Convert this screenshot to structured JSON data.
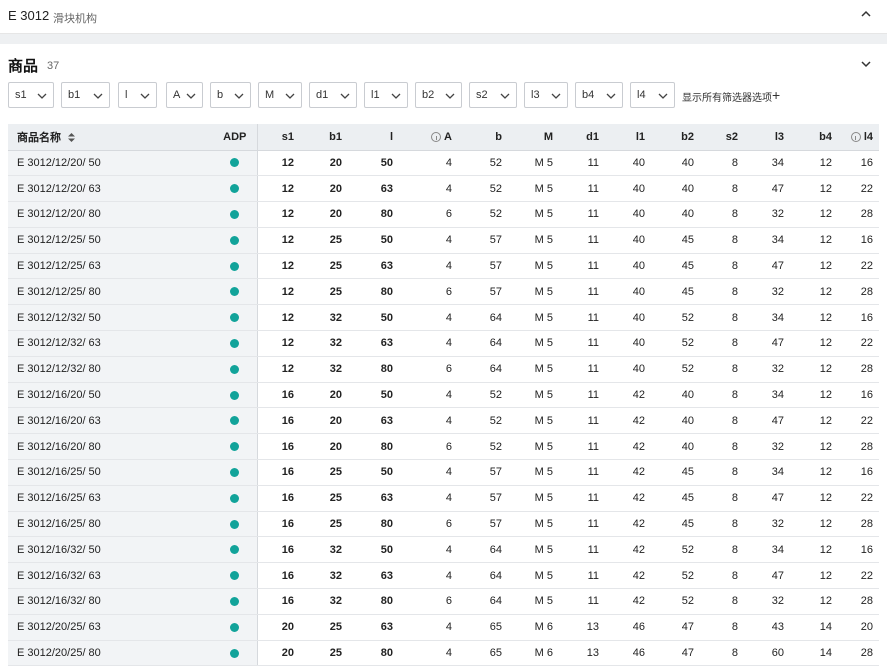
{
  "header": {
    "code": "E 3012",
    "subtitle": "滑块机构"
  },
  "section": {
    "title": "商品",
    "count": "37"
  },
  "filters": [
    {
      "label": "s1"
    },
    {
      "label": "b1"
    },
    {
      "label": "l"
    },
    {
      "label": "A"
    },
    {
      "label": "b"
    },
    {
      "label": "M"
    },
    {
      "label": "d1"
    },
    {
      "label": "l1"
    },
    {
      "label": "b2"
    },
    {
      "label": "s2"
    },
    {
      "label": "l3"
    },
    {
      "label": "b4"
    },
    {
      "label": "l4"
    }
  ],
  "show_all_filters": "显示所有筛选器选项",
  "show_all_plus": "+",
  "table": {
    "columns": [
      "商品名称",
      "ADP",
      "s1",
      "b1",
      "l",
      "A",
      "b",
      "M",
      "d1",
      "l1",
      "b2",
      "s2",
      "l3",
      "b4",
      "l4"
    ],
    "rows": [
      [
        "E 3012/12/20/ 50",
        "12",
        "20",
        "50",
        "4",
        "52",
        "M 5",
        "11",
        "40",
        "40",
        "8",
        "34",
        "12",
        "16"
      ],
      [
        "E 3012/12/20/ 63",
        "12",
        "20",
        "63",
        "4",
        "52",
        "M 5",
        "11",
        "40",
        "40",
        "8",
        "47",
        "12",
        "22"
      ],
      [
        "E 3012/12/20/ 80",
        "12",
        "20",
        "80",
        "6",
        "52",
        "M 5",
        "11",
        "40",
        "40",
        "8",
        "32",
        "12",
        "28"
      ],
      [
        "E 3012/12/25/ 50",
        "12",
        "25",
        "50",
        "4",
        "57",
        "M 5",
        "11",
        "40",
        "45",
        "8",
        "34",
        "12",
        "16"
      ],
      [
        "E 3012/12/25/ 63",
        "12",
        "25",
        "63",
        "4",
        "57",
        "M 5",
        "11",
        "40",
        "45",
        "8",
        "47",
        "12",
        "22"
      ],
      [
        "E 3012/12/25/ 80",
        "12",
        "25",
        "80",
        "6",
        "57",
        "M 5",
        "11",
        "40",
        "45",
        "8",
        "32",
        "12",
        "28"
      ],
      [
        "E 3012/12/32/ 50",
        "12",
        "32",
        "50",
        "4",
        "64",
        "M 5",
        "11",
        "40",
        "52",
        "8",
        "34",
        "12",
        "16"
      ],
      [
        "E 3012/12/32/ 63",
        "12",
        "32",
        "63",
        "4",
        "64",
        "M 5",
        "11",
        "40",
        "52",
        "8",
        "47",
        "12",
        "22"
      ],
      [
        "E 3012/12/32/ 80",
        "12",
        "32",
        "80",
        "6",
        "64",
        "M 5",
        "11",
        "40",
        "52",
        "8",
        "32",
        "12",
        "28"
      ],
      [
        "E 3012/16/20/ 50",
        "16",
        "20",
        "50",
        "4",
        "52",
        "M 5",
        "11",
        "42",
        "40",
        "8",
        "34",
        "12",
        "16"
      ],
      [
        "E 3012/16/20/ 63",
        "16",
        "20",
        "63",
        "4",
        "52",
        "M 5",
        "11",
        "42",
        "40",
        "8",
        "47",
        "12",
        "22"
      ],
      [
        "E 3012/16/20/ 80",
        "16",
        "20",
        "80",
        "6",
        "52",
        "M 5",
        "11",
        "42",
        "40",
        "8",
        "32",
        "12",
        "28"
      ],
      [
        "E 3012/16/25/ 50",
        "16",
        "25",
        "50",
        "4",
        "57",
        "M 5",
        "11",
        "42",
        "45",
        "8",
        "34",
        "12",
        "16"
      ],
      [
        "E 3012/16/25/ 63",
        "16",
        "25",
        "63",
        "4",
        "57",
        "M 5",
        "11",
        "42",
        "45",
        "8",
        "47",
        "12",
        "22"
      ],
      [
        "E 3012/16/25/ 80",
        "16",
        "25",
        "80",
        "6",
        "57",
        "M 5",
        "11",
        "42",
        "45",
        "8",
        "32",
        "12",
        "28"
      ],
      [
        "E 3012/16/32/ 50",
        "16",
        "32",
        "50",
        "4",
        "64",
        "M 5",
        "11",
        "42",
        "52",
        "8",
        "34",
        "12",
        "16"
      ],
      [
        "E 3012/16/32/ 63",
        "16",
        "32",
        "63",
        "4",
        "64",
        "M 5",
        "11",
        "42",
        "52",
        "8",
        "47",
        "12",
        "22"
      ],
      [
        "E 3012/16/32/ 80",
        "16",
        "32",
        "80",
        "6",
        "64",
        "M 5",
        "11",
        "42",
        "52",
        "8",
        "32",
        "12",
        "28"
      ],
      [
        "E 3012/20/25/ 63",
        "20",
        "25",
        "63",
        "4",
        "65",
        "M 6",
        "13",
        "46",
        "47",
        "8",
        "43",
        "14",
        "20"
      ],
      [
        "E 3012/20/25/ 80",
        "20",
        "25",
        "80",
        "4",
        "65",
        "M 6",
        "13",
        "46",
        "47",
        "8",
        "60",
        "14",
        "28"
      ]
    ]
  },
  "colors": {
    "adp_dot": "#12a39a",
    "header_bg": "#eceff2"
  },
  "icons": {
    "collapse": "chevron-up-icon",
    "expand": "chevron-down-icon",
    "sort": "sort-icon",
    "info": "info-icon",
    "adp": "status-dot-icon"
  }
}
